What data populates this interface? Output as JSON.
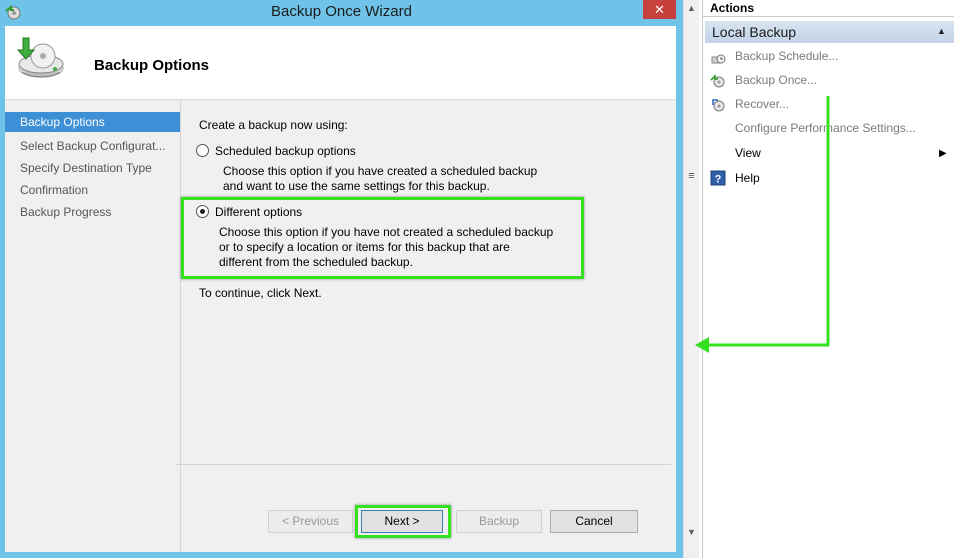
{
  "window": {
    "title": "Backup Once Wizard",
    "close_label": "✕"
  },
  "header": {
    "title": "Backup Options"
  },
  "nav": {
    "items": [
      {
        "label": "Backup Options"
      },
      {
        "label": "Select Backup Configurat..."
      },
      {
        "label": "Specify Destination Type"
      },
      {
        "label": "Confirmation"
      },
      {
        "label": "Backup Progress"
      }
    ]
  },
  "content": {
    "prompt": "Create a backup now using:",
    "option1": {
      "label": "Scheduled backup options",
      "desc1": "Choose this option if you have created a scheduled backup",
      "desc2": "and want to use the same settings for this backup."
    },
    "option2": {
      "label": "Different options",
      "desc1": "Choose this option if you have not created a scheduled backup",
      "desc2": "or to specify a location or items for this backup that are",
      "desc3": "different from the scheduled backup."
    },
    "continue": "To continue, click Next."
  },
  "buttons": {
    "previous": "< Previous",
    "next": "Next >",
    "backup": "Backup",
    "cancel": "Cancel"
  },
  "scrollbar": {
    "up": "▲",
    "down": "▼",
    "grip": "≡"
  },
  "actions": {
    "title": "Actions",
    "section": "Local Backup",
    "section_caret": "▲",
    "items": [
      {
        "label": "Backup Schedule..."
      },
      {
        "label": "Backup Once..."
      },
      {
        "label": "Recover..."
      },
      {
        "label": "Configure Performance Settings..."
      },
      {
        "label": "View",
        "arrow": "▶"
      },
      {
        "label": "Help"
      }
    ]
  },
  "colors": {
    "highlight": "#35e020",
    "window_frame": "#6fc3e8",
    "selected_nav": "#3d8fd6"
  }
}
